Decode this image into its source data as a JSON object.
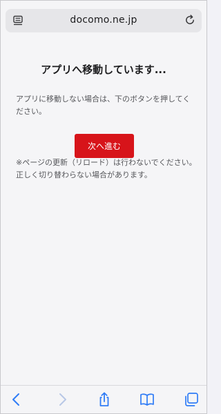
{
  "browser": {
    "url": "docomo.ne.jp",
    "reader_icon": "reader-mode-icon",
    "reload_icon": "reload-icon",
    "accent_color": "#2f7cf6"
  },
  "page": {
    "title": "アプリへ移動しています...",
    "message": "アプリに移動しない場合は、下のボタンを押してください。",
    "button_label": "次へ進む",
    "button_color": "#d7141a",
    "notice_line1": "※ページの更新（リロード）は行わないでください。",
    "notice_line2": "正しく切り替わらない場合があります。"
  },
  "toolbar": {
    "back_icon": "back-icon",
    "forward_icon": "forward-icon",
    "share_icon": "share-icon",
    "bookmarks_icon": "bookmarks-icon",
    "tabs_icon": "tabs-icon"
  }
}
